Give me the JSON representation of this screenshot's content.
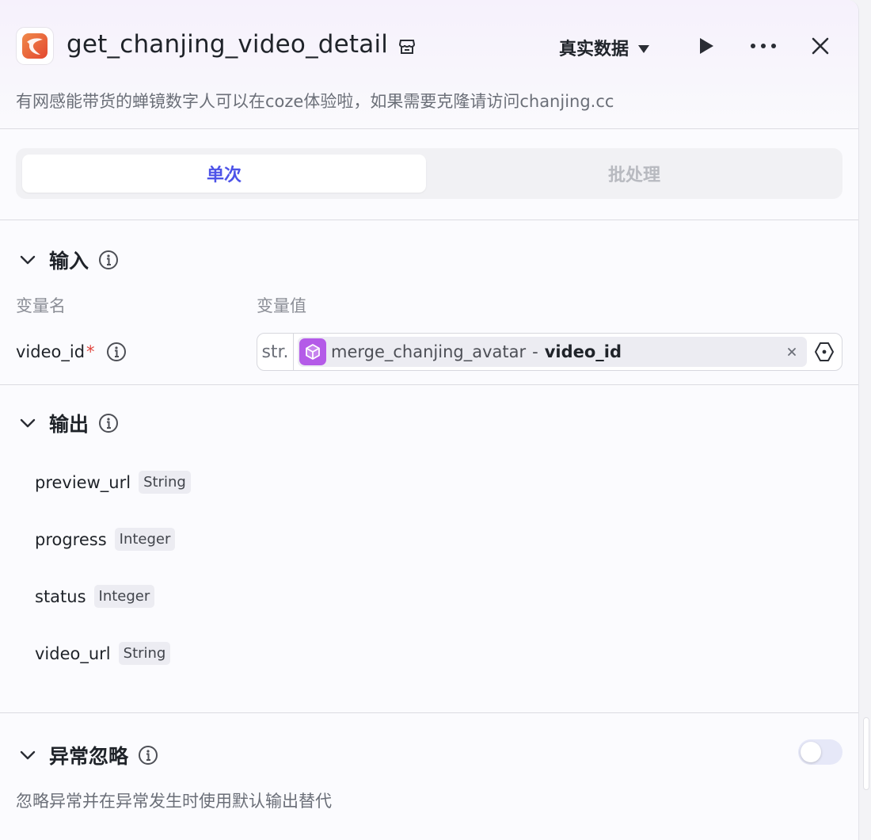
{
  "header": {
    "title": "get_chanjing_video_detail",
    "description": "有网感能带货的蝉镜数字人可以在coze体验啦，如果需要克隆请访问chanjing.cc",
    "data_mode": "真实数据"
  },
  "tabs": [
    {
      "label": "单次",
      "active": true
    },
    {
      "label": "批处理",
      "active": false
    }
  ],
  "input": {
    "title": "输入",
    "col_name": "变量名",
    "col_value": "变量值",
    "variables": [
      {
        "name": "video_id",
        "required_mark": "*",
        "type": "str.",
        "ref_node": "merge_chanjing_avatar",
        "ref_separator": "-",
        "ref_var": "video_id"
      }
    ]
  },
  "output": {
    "title": "输出",
    "fields": [
      {
        "name": "preview_url",
        "type": "String"
      },
      {
        "name": "progress",
        "type": "Integer"
      },
      {
        "name": "status",
        "type": "Integer"
      },
      {
        "name": "video_url",
        "type": "String"
      }
    ]
  },
  "exception": {
    "title": "异常忽略",
    "description": "忽略异常并在异常发生时使用默认输出替代",
    "enabled": false
  },
  "colors": {
    "accent": "#4d53e8",
    "ref_icon": "#b45be8",
    "logo": "#e8663c"
  }
}
